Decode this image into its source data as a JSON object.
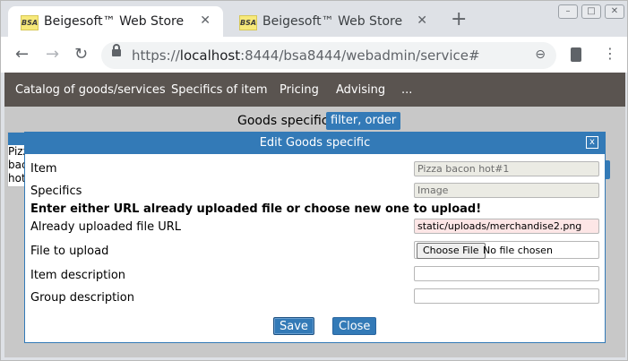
{
  "browser": {
    "tabs": [
      {
        "title": "Beigesoft™ Web Store Adm",
        "favicon": "BSA",
        "close": "✕"
      },
      {
        "title": "Beigesoft™ Web Store Adm",
        "favicon": "BSA",
        "close": "✕"
      }
    ],
    "new_tab": "+",
    "url": {
      "scheme": "https://",
      "host": "localhost",
      "rest": ":8444/bsa8444/webadmin/service#"
    }
  },
  "menu": [
    "Catalog of goods/services",
    "Specifics of item",
    "Pricing",
    "Advising",
    "..."
  ],
  "page": {
    "heading": "Goods specific",
    "filter_button": "filter, order",
    "behind_text": "Pizza bacon hot"
  },
  "dialog": {
    "title": "Edit Goods specific",
    "close_label": "x",
    "fields": {
      "item_label": "Item",
      "item_value": "Pizza bacon hot#1",
      "specifics_label": "Specifics",
      "specifics_value": "Image",
      "note": "Enter either URL already uploaded file or choose new one to upload!",
      "url_label": "Already uploaded file URL",
      "url_value": "static/uploads/merchandise2.png",
      "file_label": "File to upload",
      "choose_file": "Choose File",
      "no_file": "No file chosen",
      "item_desc_label": "Item description",
      "item_desc_value": "",
      "group_desc_label": "Group description",
      "group_desc_value": ""
    },
    "save_label": "Save",
    "close_button_label": "Close"
  },
  "colors": {
    "accent": "#337ab7",
    "menubar": "#5a5450",
    "readonly": "#ebebe4",
    "warn": "#fde6e6"
  }
}
